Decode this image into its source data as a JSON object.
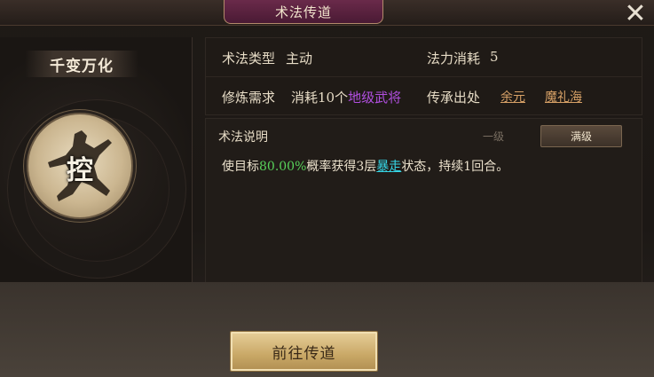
{
  "window": {
    "title": "术法传道",
    "close_symbol": "✕"
  },
  "skill": {
    "name": "千变万化",
    "emblem_char": "控"
  },
  "info": {
    "type_label": "术法类型",
    "type_value": "主动",
    "mana_label": "法力消耗",
    "mana_value": "5",
    "req_label": "修炼需求",
    "req_prefix": "消耗10个",
    "req_highlight": "地级武将",
    "source_label": "传承出处",
    "source_links": [
      "余元",
      "魔礼海"
    ]
  },
  "description": {
    "header": "术法说明",
    "tabs": [
      "一级",
      "满级"
    ],
    "selected_tab": "满级",
    "text_parts": [
      "使目标",
      "80.00%",
      "概率获得3层",
      "暴走",
      "状态，持续1回合。"
    ]
  },
  "actions": {
    "go_label": "前往传道"
  },
  "colors": {
    "purple_highlight": "#b14fe0",
    "green_value": "#58d25a",
    "cyan_keyword": "#36d6e6",
    "link_orange": "#d6a066"
  },
  "icons": [
    "close-icon",
    "skill-figure-icon"
  ]
}
